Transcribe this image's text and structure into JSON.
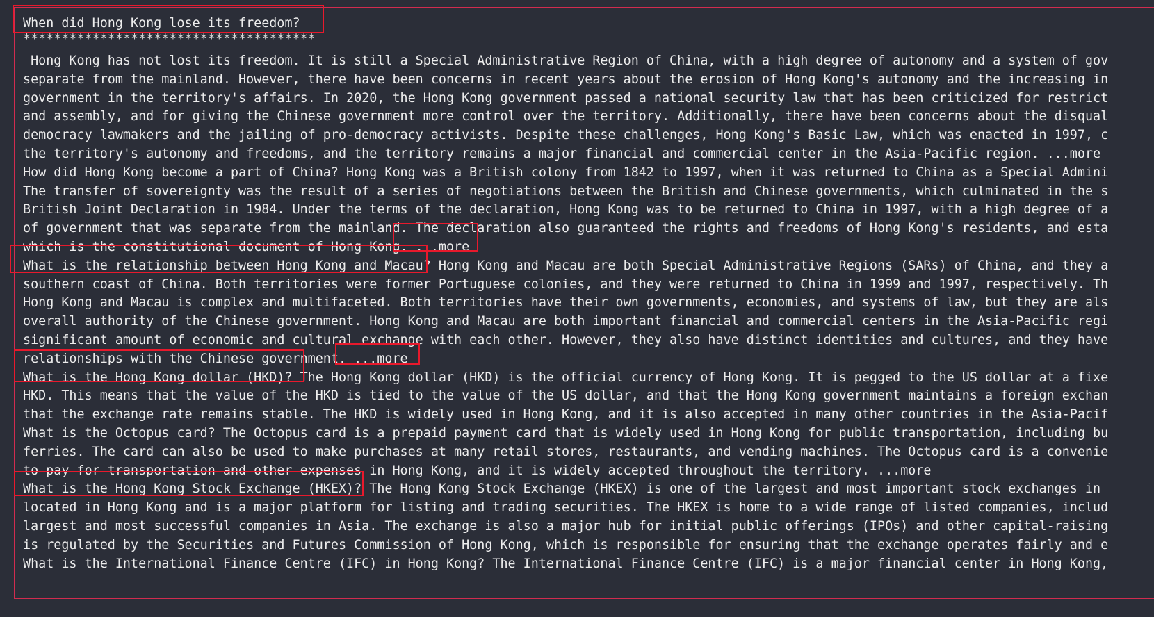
{
  "title": "When did Hong Kong lose its freedom?",
  "separator": "**************************************",
  "lines": [
    " Hong Kong has not lost its freedom. It is still a Special Administrative Region of China, with a high degree of autonomy and a system of gov",
    "separate from the mainland. However, there have been concerns in recent years about the erosion of Hong Kong's autonomy and the increasing in",
    "government in the territory's affairs. In 2020, the Hong Kong government passed a national security law that has been criticized for restrict",
    "and assembly, and for giving the Chinese government more control over the territory. Additionally, there have been concerns about the disqual",
    "democracy lawmakers and the jailing of pro-democracy activists. Despite these challenges, Hong Kong's Basic Law, which was enacted in 1997, c",
    "the territory's autonomy and freedoms, and the territory remains a major financial and commercial center in the Asia-Pacific region. ...more",
    "How did Hong Kong become a part of China? Hong Kong was a British colony from 1842 to 1997, when it was returned to China as a Special Admini",
    "The transfer of sovereignty was the result of a series of negotiations between the British and Chinese governments, which culminated in the s",
    "British Joint Declaration in 1984. Under the terms of the declaration, Hong Kong was to be returned to China in 1997, with a high degree of a",
    "of government that was separate from the mainland. The declaration also guaranteed the rights and freedoms of Hong Kong's residents, and esta",
    "which is the constitutional document of Hong Kong. ...more",
    "What is the relationship between Hong Kong and Macau? Hong Kong and Macau are both Special Administrative Regions (SARs) of China, and they a",
    "southern coast of China. Both territories were former Portuguese colonies, and they were returned to China in 1999 and 1997, respectively. Th",
    "Hong Kong and Macau is complex and multifaceted. Both territories have their own governments, economies, and systems of law, but they are als",
    "overall authority of the Chinese government. Hong Kong and Macau are both important financial and commercial centers in the Asia-Pacific regi",
    "significant amount of economic and cultural exchange with each other. However, they also have distinct identities and cultures, and they have",
    "relationships with the Chinese government. ...more",
    "What is the Hong Kong dollar (HKD)? The Hong Kong dollar (HKD) is the official currency of Hong Kong. It is pegged to the US dollar at a fixe",
    "HKD. This means that the value of the HKD is tied to the value of the US dollar, and that the Hong Kong government maintains a foreign exchan",
    "that the exchange rate remains stable. The HKD is widely used in Hong Kong, and it is also accepted in many other countries in the Asia-Pacif",
    "What is the Octopus card? The Octopus card is a prepaid payment card that is widely used in Hong Kong for public transportation, including bu",
    "ferries. The card can also be used to make purchases at many retail stores, restaurants, and vending machines. The Octopus card is a convenie",
    "to pay for transportation and other expenses in Hong Kong, and it is widely accepted throughout the territory. ...more",
    "What is the Hong Kong Stock Exchange (HKEX)? The Hong Kong Stock Exchange (HKEX) is one of the largest and most important stock exchanges in",
    "located in Hong Kong and is a major platform for listing and trading securities. The HKEX is home to a wide range of listed companies, includ",
    "largest and most successful companies in Asia. The exchange is also a major hub for initial public offerings (IPOs) and other capital-raising",
    "is regulated by the Securities and Futures Commission of Hong Kong, which is responsible for ensuring that the exchange operates fairly and e",
    "What is the International Finance Centre (IFC) in Hong Kong? The International Finance Centre (IFC) is a major financial center in Hong Kong,"
  ],
  "colors": {
    "background": "#2b2e38",
    "text": "#ececec",
    "frame_border": "#d12c4f",
    "highlight_box": "#e8192c"
  }
}
